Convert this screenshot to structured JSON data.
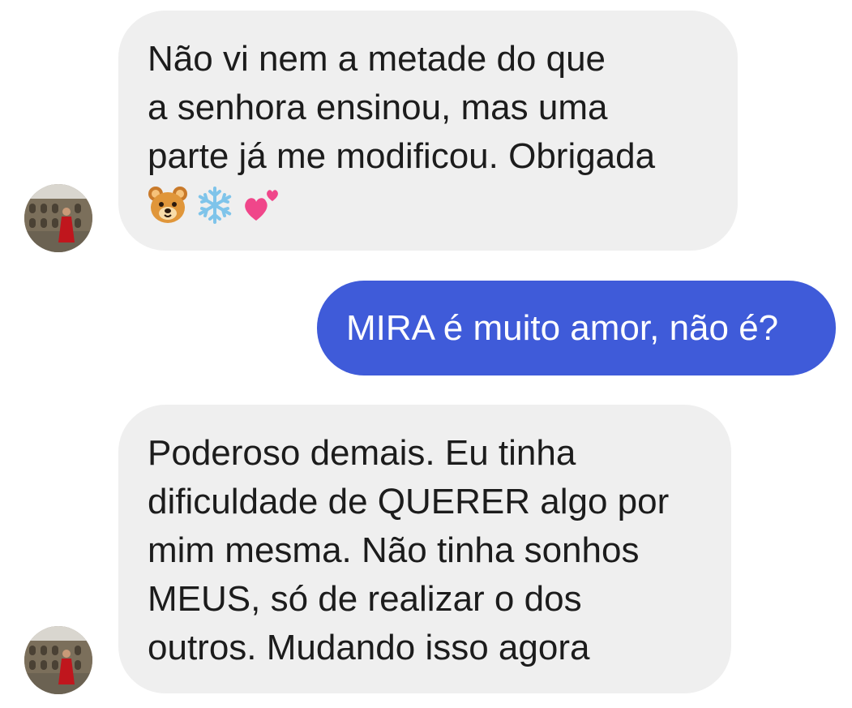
{
  "conversation": {
    "messages": [
      {
        "direction": "incoming",
        "lines": [
          "Não vi nem a metade do que",
          "a senhora ensinou, mas uma",
          "parte já me modificou. Obrigada"
        ],
        "emojis": [
          "bear-face",
          "snowflake",
          "two-hearts"
        ]
      },
      {
        "direction": "outgoing",
        "lines": [
          "MIRA é muito amor, não é?"
        ]
      },
      {
        "direction": "incoming",
        "lines": [
          "Poderoso demais. Eu tinha",
          "dificuldade de QUERER algo por",
          "mim mesma. Não tinha sonhos",
          "MEUS, só de realizar o dos",
          "outros. Mudando isso agora"
        ]
      }
    ]
  },
  "colors": {
    "incoming_bubble": "#efefef",
    "outgoing_bubble": "#3f5bd9",
    "incoming_text": "#1c1c1c",
    "outgoing_text": "#ffffff"
  }
}
